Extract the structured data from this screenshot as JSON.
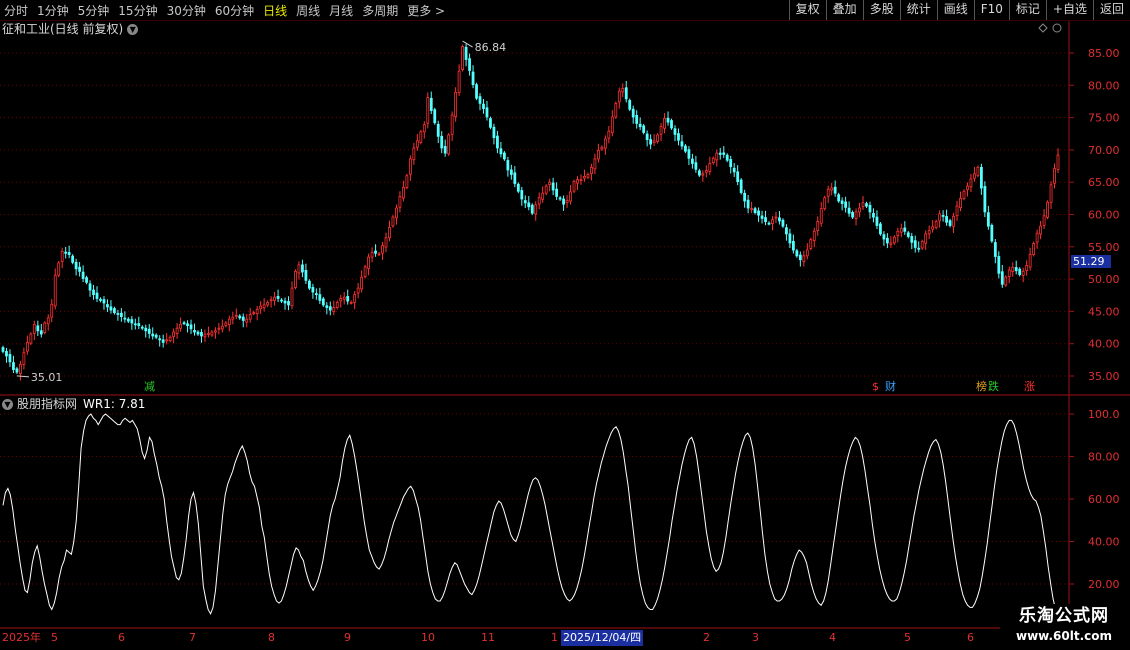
{
  "toolbar": {
    "periods": [
      "分时",
      "1分钟",
      "5分钟",
      "15分钟",
      "30分钟",
      "60分钟",
      "日线",
      "周线",
      "月线",
      "多周期",
      "更多 >"
    ],
    "active_period": "日线",
    "actions": [
      "复权",
      "叠加",
      "多股",
      "统计",
      "画线",
      "F10",
      "标记",
      "+自选",
      "返回"
    ]
  },
  "main_chart": {
    "title": "征和工业(日线 前复权)",
    "high_label": "86.84",
    "low_label": "35.01",
    "current_price": "51.29",
    "y_ticks": [
      "85.00",
      "80.00",
      "75.00",
      "70.00",
      "65.00",
      "60.00",
      "55.00",
      "50.00",
      "45.00",
      "40.00",
      "35.00"
    ],
    "markers": [
      {
        "text": "减",
        "color": "#28c828"
      },
      {
        "text": "$",
        "color": "#ff3030"
      },
      {
        "text": "财",
        "color": "#3aa0ff"
      },
      {
        "text": "榜",
        "color": "#e0a020"
      },
      {
        "text": "跌",
        "color": "#28c828"
      },
      {
        "text": "涨",
        "color": "#ff3030"
      }
    ]
  },
  "indicator": {
    "name": "股朋指标网",
    "value_label": "WR1: 7.81",
    "y_ticks": [
      "100.0",
      "80.00",
      "60.00",
      "40.00",
      "20.00"
    ]
  },
  "x_axis": {
    "labels": [
      "2025年",
      "5",
      "6",
      "7",
      "8",
      "9",
      "10",
      "11",
      "1",
      "2025/12/04/四",
      "2",
      "3",
      "4",
      "5",
      "6"
    ]
  },
  "watermark": {
    "line1": "乐淘公式网",
    "line2": "www.60lt.com"
  },
  "colors": {
    "up": "#ff3232",
    "down": "#54ffff",
    "wr": "#ffffff",
    "grid": "#6a0000",
    "axis": "#a01010"
  },
  "chart_data": [
    {
      "type": "candlestick",
      "title": "征和工业(日线 前复权)",
      "ylim": [
        32.5,
        88.5
      ],
      "close": [
        38.8,
        38.1,
        37.2,
        36.0,
        35.6,
        36.8,
        38.6,
        40.2,
        41.5,
        43.0,
        42.0,
        41.5,
        43.2,
        44.0,
        46.1,
        50.6,
        52.5,
        54.3,
        54.0,
        53.8,
        52.6,
        51.6,
        51.2,
        50.1,
        49.5,
        48.3,
        47.6,
        47.0,
        46.7,
        46.3,
        45.7,
        45.2,
        44.8,
        44.6,
        44.2,
        43.8,
        43.5,
        43.2,
        43.0,
        42.8,
        42.4,
        42.0,
        41.6,
        41.2,
        41.0,
        40.6,
        40.2,
        40.6,
        41.0,
        41.8,
        42.4,
        43.0,
        43.2,
        42.8,
        42.3,
        41.8,
        41.5,
        41.2,
        41.4,
        41.6,
        41.8,
        42.0,
        42.4,
        42.7,
        43.2,
        43.8,
        44.1,
        44.4,
        44.0,
        43.6,
        43.8,
        44.5,
        44.8,
        45.3,
        45.8,
        46.0,
        46.4,
        46.8,
        47.2,
        47.0,
        46.6,
        46.3,
        46.0,
        48.6,
        51.2,
        52.2,
        51.1,
        49.8,
        48.6,
        48.0,
        47.6,
        46.7,
        46.0,
        45.6,
        45.2,
        45.6,
        46.4,
        47.0,
        47.2,
        46.6,
        46.4,
        47.6,
        48.6,
        50.3,
        51.9,
        53.4,
        54.1,
        54.0,
        53.9,
        55.2,
        56.4,
        58.0,
        59.6,
        61.0,
        62.8,
        64.2,
        66.0,
        68.6,
        70.3,
        71.4,
        72.8,
        73.9,
        78.1,
        76.1,
        74.2,
        72.1,
        70.3,
        69.5,
        72.3,
        75.4,
        78.9,
        82.2,
        86.0,
        84.0,
        82.3,
        80.1,
        78.0,
        77.2,
        76.4,
        75.1,
        73.5,
        71.9,
        70.3,
        69.4,
        68.6,
        66.9,
        66.2,
        64.8,
        63.6,
        62.4,
        61.8,
        61.2,
        60.2,
        61.5,
        62.6,
        63.3,
        64.4,
        65.0,
        63.8,
        62.8,
        62.4,
        61.6,
        62.2,
        63.5,
        65.1,
        65.4,
        65.4,
        65.9,
        66.2,
        67.3,
        68.6,
        69.9,
        70.4,
        71.7,
        72.9,
        75.1,
        77.2,
        79.1,
        79.5,
        77.9,
        76.3,
        75.1,
        74.1,
        73.6,
        72.7,
        71.6,
        70.9,
        71.4,
        72.3,
        73.6,
        74.9,
        74.3,
        73.4,
        72.4,
        71.5,
        70.6,
        69.8,
        68.7,
        67.9,
        67.0,
        66.1,
        66.3,
        66.8,
        67.9,
        68.7,
        69.5,
        69.3,
        69.3,
        68.4,
        67.4,
        66.6,
        65.1,
        63.4,
        62.1,
        61.0,
        60.9,
        60.3,
        59.9,
        59.4,
        58.9,
        58.6,
        59.2,
        59.6,
        59.0,
        58.2,
        57.0,
        55.6,
        54.5,
        53.6,
        53.0,
        53.6,
        54.5,
        56.1,
        57.4,
        58.9,
        60.9,
        62.6,
        63.9,
        64.1,
        63.3,
        62.1,
        61.7,
        61.1,
        60.2,
        59.6,
        60.4,
        61.0,
        61.8,
        61.3,
        60.4,
        59.6,
        58.3,
        57.0,
        56.2,
        55.6,
        55.6,
        56.5,
        57.4,
        57.8,
        57.4,
        56.6,
        55.7,
        54.9,
        54.7,
        55.8,
        57.0,
        57.5,
        58.1,
        58.9,
        60.1,
        59.7,
        58.8,
        58.3,
        59.7,
        61.3,
        62.5,
        63.6,
        64.4,
        65.5,
        66.3,
        67.3,
        64.1,
        60.4,
        58.2,
        55.9,
        53.5,
        50.9,
        49.2,
        50.3,
        51.4,
        51.8,
        51.3,
        50.7,
        51.2,
        52.1,
        53.8,
        55.5,
        57.1,
        58.2,
        59.8,
        61.9,
        64.6,
        67.1,
        69.2
      ]
    },
    {
      "type": "line",
      "title": "股朋指标网",
      "series": [
        {
          "name": "WR1",
          "values": [
            57,
            63,
            65,
            62,
            55,
            46,
            38,
            30,
            23,
            17,
            16,
            22,
            30,
            35,
            38,
            33,
            26,
            20,
            15,
            10,
            8,
            11,
            16,
            23,
            28,
            31,
            36,
            35,
            34,
            40,
            50,
            66,
            84,
            92,
            97,
            99,
            100,
            98,
            97,
            95,
            97,
            99,
            100,
            99,
            98,
            97,
            96,
            95,
            95,
            97,
            98,
            97,
            96,
            97,
            95,
            93,
            88,
            82,
            79,
            83,
            89,
            87,
            81,
            76,
            70,
            66,
            60,
            50,
            41,
            33,
            28,
            23,
            22,
            25,
            32,
            41,
            52,
            60,
            63,
            58,
            48,
            34,
            19,
            13,
            8,
            6,
            9,
            17,
            29,
            41,
            53,
            62,
            67,
            70,
            73,
            77,
            80,
            83,
            85,
            82,
            78,
            72,
            68,
            66,
            61,
            56,
            47,
            42,
            33,
            25,
            19,
            15,
            12,
            11,
            12,
            15,
            19,
            24,
            29,
            34,
            37,
            36,
            33,
            31,
            26,
            22,
            19,
            17,
            19,
            22,
            26,
            31,
            38,
            45,
            52,
            57,
            60,
            65,
            70,
            78,
            84,
            88,
            90,
            86,
            80,
            73,
            65,
            57,
            49,
            42,
            36,
            33,
            30,
            28,
            27,
            29,
            32,
            36,
            41,
            45,
            49,
            52,
            55,
            58,
            61,
            63,
            65,
            66,
            64,
            60,
            56,
            50,
            42,
            34,
            26,
            20,
            16,
            13,
            12,
            12,
            14,
            17,
            21,
            25,
            28,
            30,
            29,
            26,
            23,
            20,
            18,
            16,
            15,
            17,
            20,
            24,
            29,
            34,
            39,
            44,
            49,
            54,
            57,
            59,
            58,
            55,
            51,
            47,
            43,
            41,
            40,
            43,
            47,
            52,
            57,
            62,
            66,
            69,
            70,
            69,
            66,
            62,
            57,
            51,
            45,
            39,
            33,
            27,
            22,
            18,
            15,
            13,
            12,
            13,
            15,
            18,
            22,
            27,
            33,
            40,
            47,
            54,
            61,
            67,
            72,
            77,
            81,
            85,
            88,
            91,
            93,
            94,
            92,
            88,
            82,
            74,
            66,
            56,
            46,
            36,
            27,
            20,
            15,
            11,
            9,
            8,
            8,
            10,
            13,
            17,
            22,
            28,
            35,
            42,
            50,
            57,
            64,
            70,
            76,
            81,
            85,
            88,
            89,
            86,
            80,
            72,
            63,
            54,
            45,
            38,
            32,
            28,
            26,
            27,
            30,
            35,
            42,
            50,
            58,
            65,
            72,
            78,
            83,
            87,
            90,
            91,
            89,
            84,
            76,
            66,
            55,
            44,
            34,
            26,
            20,
            16,
            13,
            12,
            12,
            13,
            15,
            18,
            22,
            27,
            31,
            34,
            36,
            35,
            33,
            30,
            25,
            20,
            16,
            13,
            11,
            10,
            12,
            16,
            22,
            30,
            38,
            46,
            54,
            62,
            69,
            75,
            80,
            84,
            87,
            89,
            88,
            85,
            80,
            73,
            65,
            57,
            48,
            40,
            33,
            27,
            22,
            18,
            15,
            13,
            12,
            12,
            13,
            16,
            20,
            25,
            31,
            38,
            45,
            52,
            58,
            64,
            69,
            74,
            78,
            82,
            85,
            87,
            88,
            86,
            82,
            76,
            68,
            59,
            50,
            41,
            33,
            26,
            20,
            15,
            12,
            10,
            9,
            9,
            11,
            14,
            18,
            24,
            31,
            39,
            48,
            57,
            66,
            74,
            81,
            87,
            92,
            95,
            97,
            97,
            95,
            91,
            86,
            80,
            74,
            69,
            65,
            62,
            60,
            59,
            56,
            52,
            45,
            37,
            28,
            20,
            13,
            8,
            5
          ]
        }
      ],
      "ylim": [
        0,
        105
      ]
    }
  ]
}
